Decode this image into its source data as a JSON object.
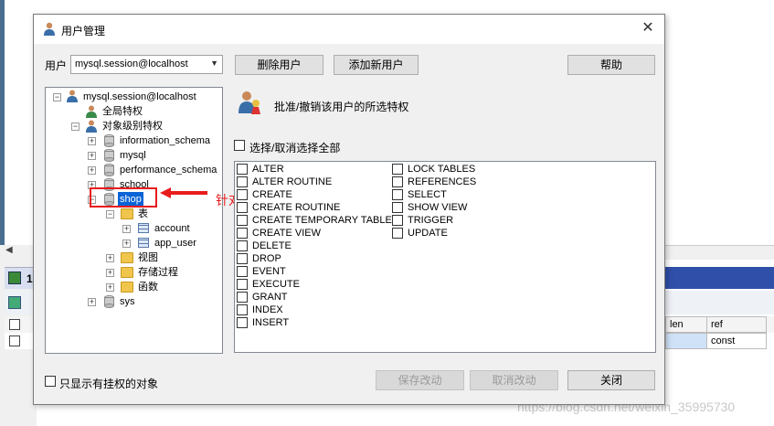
{
  "dialog": {
    "title": "用户管理",
    "user_label": "用户",
    "user_value": "mysql.session@localhost",
    "buttons": {
      "delete_user": "删除用户",
      "add_user": "添加新用户",
      "help": "帮助",
      "save": "保存改动",
      "cancel": "取消改动",
      "close": "关闭"
    },
    "tree": {
      "root": "mysql.session@localhost",
      "global": "全局特权",
      "object_level": "对象级别特权",
      "schemas": [
        "information_schema",
        "mysql",
        "performance_schema",
        "school",
        "shop",
        "sys"
      ],
      "shop_children": {
        "tables": "表",
        "table_items": [
          "account",
          "app_user"
        ],
        "views": "视图",
        "procedures": "存储过程",
        "functions": "函数"
      }
    },
    "grant_title": "批准/撤销该用户的所选特权",
    "select_all": "选择/取消选择全部",
    "privileges_col1": [
      "ALTER",
      "ALTER ROUTINE",
      "CREATE",
      "CREATE ROUTINE",
      "CREATE TEMPORARY TABLES",
      "CREATE VIEW",
      "DELETE",
      "DROP",
      "EVENT",
      "EXECUTE",
      "GRANT",
      "INDEX",
      "INSERT"
    ],
    "privileges_col2": [
      "LOCK TABLES",
      "REFERENCES",
      "SELECT",
      "SHOW VIEW",
      "TRIGGER",
      "UPDATE"
    ],
    "only_show_label": "只显示有挂权的对象",
    "annotation": "针对该数据库的权限"
  },
  "background": {
    "tab_label": "1",
    "grid_headers": [
      "len",
      "ref"
    ],
    "grid_row": [
      "const"
    ],
    "watermark": "https://blog.csdn.net/weixin_35995730"
  },
  "colors": {
    "selection": "#0a64d6",
    "annotation": "#e81c1c",
    "dialog_bg": "#f0f0f0"
  }
}
